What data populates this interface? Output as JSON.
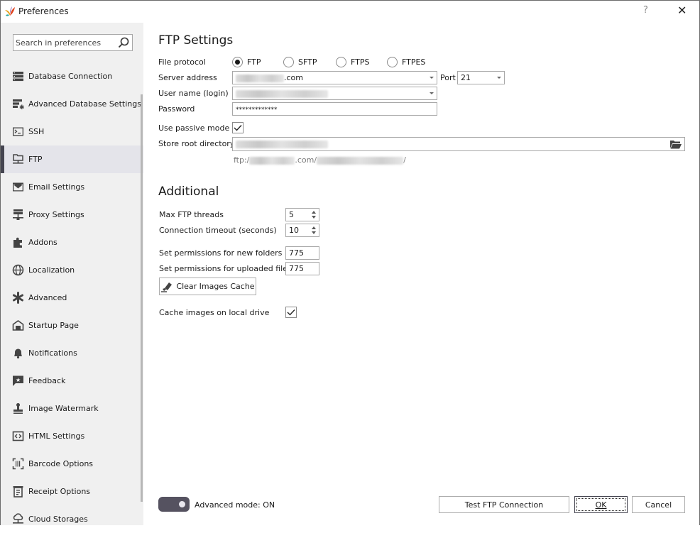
{
  "window": {
    "title": "Preferences",
    "help_label": "?",
    "close_label": "✕"
  },
  "sidebar": {
    "search_placeholder": "Search in preferences",
    "items": [
      {
        "label": "Database Connection",
        "icon": "database-icon",
        "active": false
      },
      {
        "label": "Advanced Database Settings",
        "icon": "database-settings-icon",
        "active": false
      },
      {
        "label": "SSH",
        "icon": "terminal-icon",
        "active": false
      },
      {
        "label": "FTP",
        "icon": "network-folder-icon",
        "active": true
      },
      {
        "label": "Email Settings",
        "icon": "envelope-icon",
        "active": false
      },
      {
        "label": "Proxy Settings",
        "icon": "proxy-server-icon",
        "active": false
      },
      {
        "label": "Addons",
        "icon": "puzzle-icon",
        "active": false
      },
      {
        "label": "Localization",
        "icon": "globe-icon",
        "active": false
      },
      {
        "label": "Advanced",
        "icon": "asterisk-icon",
        "active": false
      },
      {
        "label": "Startup Page",
        "icon": "home-icon",
        "active": false
      },
      {
        "label": "Notifications",
        "icon": "bell-icon",
        "active": false
      },
      {
        "label": "Feedback",
        "icon": "star-bubble-icon",
        "active": false
      },
      {
        "label": "Image Watermark",
        "icon": "stamp-icon",
        "active": false
      },
      {
        "label": "HTML Settings",
        "icon": "code-icon",
        "active": false
      },
      {
        "label": "Barcode Options",
        "icon": "barcode-icon",
        "active": false
      },
      {
        "label": "Receipt Options",
        "icon": "receipt-icon",
        "active": false
      },
      {
        "label": "Cloud Storages",
        "icon": "cloud-network-icon",
        "active": false
      }
    ]
  },
  "ftp": {
    "heading": "FTP Settings",
    "file_protocol_label": "File protocol",
    "protocols": [
      {
        "label": "FTP",
        "selected": true
      },
      {
        "label": "SFTP",
        "selected": false
      },
      {
        "label": "FTPS",
        "selected": false
      },
      {
        "label": "FTPES",
        "selected": false
      }
    ],
    "server_address_label": "Server address",
    "server_address_suffix": ".com",
    "port_label": "Port",
    "port_value": "21",
    "username_label": "User name (login)",
    "password_label": "Password",
    "password_value": "*************",
    "passive_mode_label": "Use passive mode",
    "passive_mode_checked": true,
    "store_root_label": "Store root directory",
    "url_prefix": "ftp:/",
    "url_mid": ".com/",
    "url_suffix": "/"
  },
  "additional": {
    "heading": "Additional",
    "max_threads_label": "Max FTP threads",
    "max_threads_value": "5",
    "timeout_label": "Connection timeout (seconds)",
    "timeout_value": "10",
    "folder_perm_label": "Set permissions for new folders",
    "folder_perm_value": "775",
    "file_perm_label": "Set permissions for uploaded files",
    "file_perm_value": "775",
    "clear_cache_label": "Clear Images Cache",
    "cache_local_label": "Cache images on local drive",
    "cache_local_checked": true
  },
  "footer": {
    "advanced_mode_label": "Advanced mode: ON",
    "advanced_mode_on": true,
    "test_button": "Test FTP Connection",
    "ok_button": "OK",
    "cancel_button": "Cancel"
  }
}
